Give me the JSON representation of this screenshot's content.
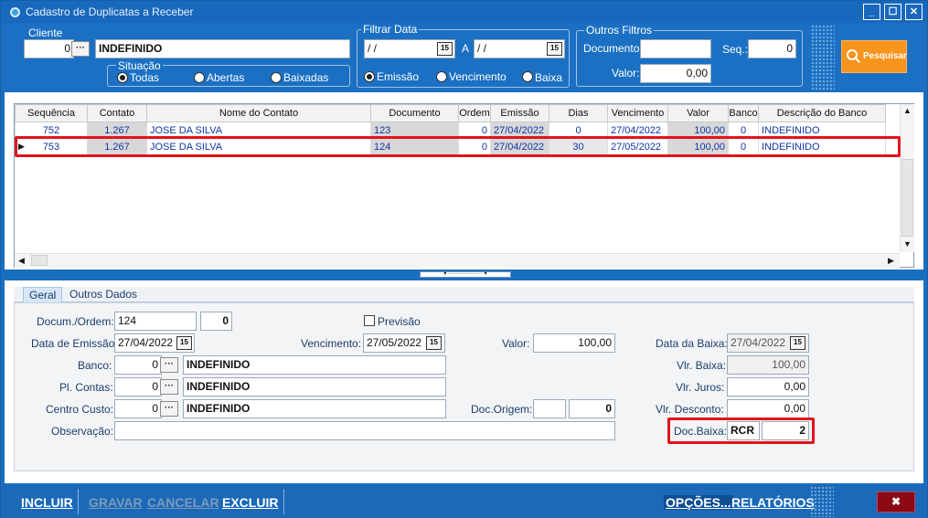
{
  "window": {
    "title": "Cadastro de Duplicatas a Receber"
  },
  "filter": {
    "cliente_label": "Cliente",
    "cliente_code": "0",
    "cliente_name": "INDEFINIDO",
    "situacao_label": "Situação",
    "situacao_options": [
      "Todas",
      "Abertas",
      "Baixadas"
    ],
    "situacao_selected": "Todas",
    "filtrar_data_label": "Filtrar Data",
    "date_from": "/ /",
    "date_sep": "A",
    "date_to": "/ /",
    "data_options": [
      "Emissão",
      "Vencimento",
      "Baixa"
    ],
    "data_selected": "Emissão",
    "outros_label": "Outros Filtros",
    "documento_label": "Documento:",
    "documento_value": "",
    "seq_label": "Seq.:",
    "seq_value": "0",
    "valor_label": "Valor:",
    "valor_value": "0,00",
    "pesquisar_label": "Pesquisar"
  },
  "grid": {
    "columns": [
      "Sequência",
      "Contato",
      "Nome do Contato",
      "Documento",
      "Ordem",
      "Emissão",
      "Dias",
      "Vencimento",
      "Valor",
      "Banco",
      "Descrição do Banco"
    ],
    "rows": [
      [
        "752",
        "1.267",
        "JOSE DA SILVA",
        "123",
        "0",
        "27/04/2022",
        "0",
        "27/04/2022",
        "100,00",
        "0",
        "INDEFINIDO"
      ],
      [
        "753",
        "1.267",
        "JOSE DA SILVA",
        "124",
        "0",
        "27/04/2022",
        "30",
        "27/05/2022",
        "100,00",
        "0",
        "INDEFINIDO"
      ]
    ],
    "selected_row": 1
  },
  "tabs": [
    "Geral",
    "Outros Dados"
  ],
  "detail": {
    "docum_label": "Docum./Ordem:",
    "docum_value": "124",
    "ordem_value": "0",
    "previsao_label": "Previsão",
    "emissao_label": "Data de Emissão:",
    "emissao_value": "27/04/2022",
    "vencimento_label": "Vencimento:",
    "vencimento_value": "27/05/2022",
    "valor_label": "Valor:",
    "valor_value": "100,00",
    "data_baixa_label": "Data da Baixa:",
    "data_baixa_value": "27/04/2022",
    "banco_label": "Banco:",
    "banco_code": "0",
    "banco_name": "INDEFINIDO",
    "vlr_baixa_label": "Vlr. Baixa:",
    "vlr_baixa_value": "100,00",
    "plcontas_label": "Pl. Contas:",
    "plcontas_code": "0",
    "plcontas_name": "INDEFINIDO",
    "vlr_juros_label": "Vlr. Juros:",
    "vlr_juros_value": "0,00",
    "ccusto_label": "Centro Custo:",
    "ccusto_code": "0",
    "ccusto_name": "INDEFINIDO",
    "doc_origem_label": "Doc.Origem:",
    "doc_origem_a": "",
    "doc_origem_b": "0",
    "vlr_desconto_label": "Vlr. Desconto:",
    "vlr_desconto_value": "0,00",
    "observacao_label": "Observação:",
    "observacao_value": "",
    "doc_baixa_label": "Doc.Baixa:",
    "doc_baixa_code": "RCR",
    "doc_baixa_num": "2"
  },
  "toolbar": {
    "incluir": "INCLUIR",
    "gravar": "GRAVAR",
    "cancelar": "CANCELAR",
    "excluir": "EXCLUIR",
    "opcoes": "OPÇÕES...",
    "relatorios": "RELATÓRIOS",
    "close": "✖"
  },
  "colors": {
    "accent": "#f7941d",
    "frame": "#1b70c3",
    "highlight": "#e1141c"
  }
}
